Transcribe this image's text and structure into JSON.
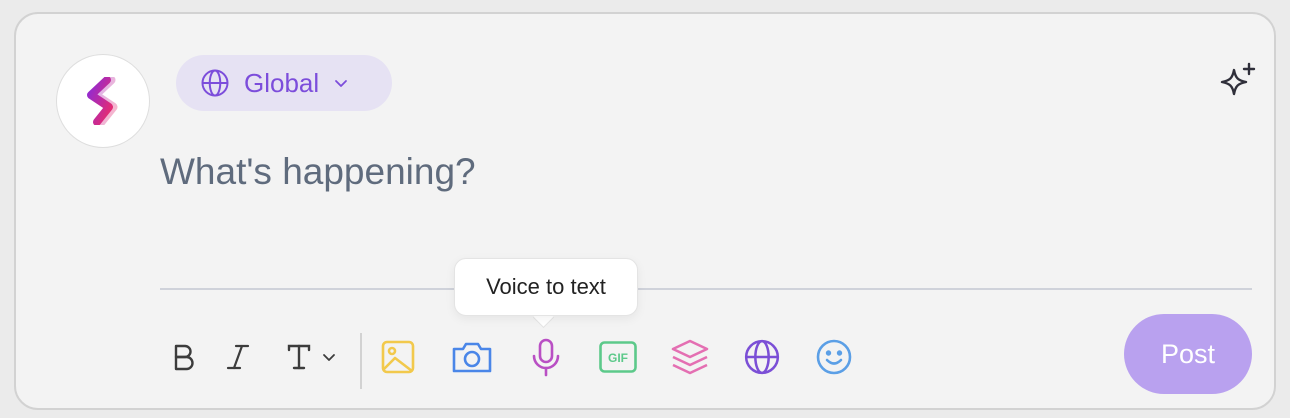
{
  "audience": {
    "label": "Global",
    "icon": "globe-icon",
    "color": "#7c4ddb",
    "background": "#e6e2f3"
  },
  "composer": {
    "placeholder": "What's happening?"
  },
  "toolbar": {
    "items": [
      {
        "name": "bold-icon",
        "color": "#3c3c3c"
      },
      {
        "name": "italic-icon",
        "color": "#3c3c3c"
      },
      {
        "name": "text-style-icon",
        "color": "#3c3c3c"
      },
      {
        "name": "image-icon",
        "color": "#f2c94c"
      },
      {
        "name": "camera-icon",
        "color": "#4a86e8"
      },
      {
        "name": "microphone-icon",
        "color": "#b94fc4"
      },
      {
        "name": "gif-icon",
        "color": "#5cc98a"
      },
      {
        "name": "layers-icon",
        "color": "#e46fb2"
      },
      {
        "name": "globe-icon",
        "color": "#7b4fd6"
      },
      {
        "name": "emoji-icon",
        "color": "#5b9fe6"
      }
    ],
    "gif_label": "GIF"
  },
  "tooltip": {
    "text": "Voice to text"
  },
  "post": {
    "label": "Post",
    "background": "#b9a1ef"
  },
  "brand": {
    "icon": "brand-logo-icon",
    "color": "#c2256e"
  }
}
